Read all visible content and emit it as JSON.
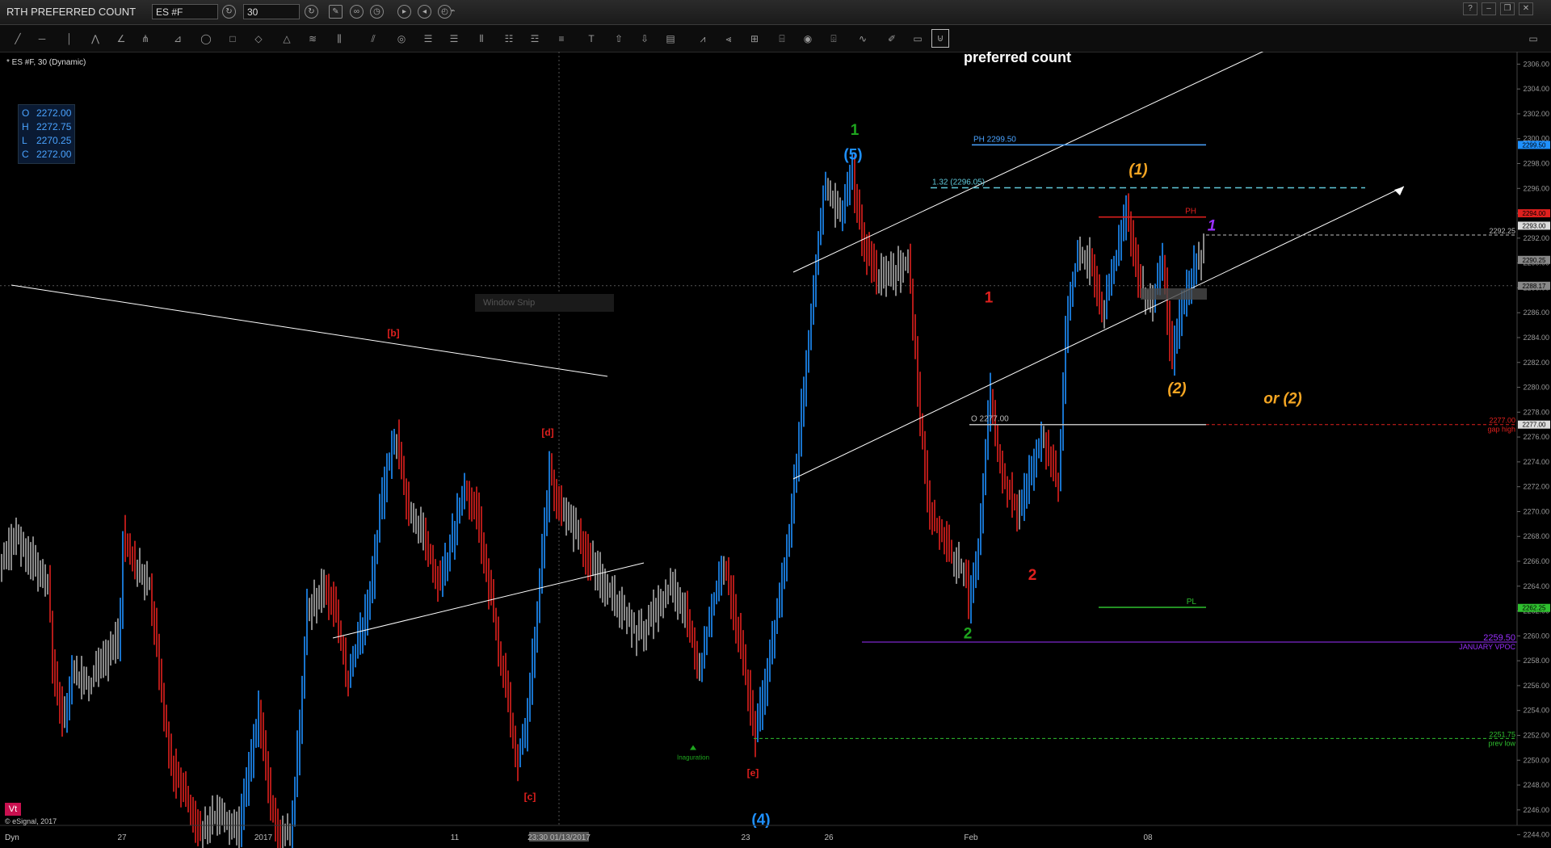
{
  "window": {
    "title": "RTH  PREFERRED COUNT",
    "symbol_field": "ES #F",
    "interval_field": "30",
    "controls": [
      "?",
      "–",
      "❐",
      "✕"
    ]
  },
  "chart_info": {
    "symbol_label": "* ES #F, 30 (Dynamic)",
    "ohlc": {
      "O": "2272.00",
      "H": "2272.75",
      "L": "2270.25",
      "C": "2272.00"
    },
    "vt_badge": "Vt",
    "copyright": "© eSignal, 2017",
    "dyn_label": "Dyn",
    "window_snip": "Window Snip"
  },
  "chart_data": {
    "type": "bar",
    "title": "preferred count",
    "ylim": [
      2243,
      2307
    ],
    "y_ticks": [
      "2306.00",
      "2304.00",
      "2302.00",
      "2300.00",
      "2298.00",
      "2296.00",
      "2294.00",
      "2292.00",
      "2290.00",
      "2288.00",
      "2286.00",
      "2284.00",
      "2282.00",
      "2280.00",
      "2278.00",
      "2276.00",
      "2274.00",
      "2272.00",
      "2270.00",
      "2268.00",
      "2266.00",
      "2264.00",
      "2262.00",
      "2260.00",
      "2258.00",
      "2256.00",
      "2254.00",
      "2252.00",
      "2250.00",
      "2248.00",
      "2246.00",
      "2244.00"
    ],
    "x_labels": [
      {
        "label": "27",
        "t": 151
      },
      {
        "label": "2017",
        "t": 326
      },
      {
        "label": "11",
        "t": 563
      },
      {
        "label": "23:30 01/13/2017",
        "t": 692,
        "highlight": true
      },
      {
        "label": "23",
        "t": 923
      },
      {
        "label": "26",
        "t": 1026
      },
      {
        "label": "Feb",
        "t": 1202
      },
      {
        "label": "08",
        "t": 1421
      }
    ],
    "price_path": [
      [
        0,
        2266
      ],
      [
        20,
        2268
      ],
      [
        40,
        2266
      ],
      [
        60,
        2264
      ],
      [
        65,
        2258
      ],
      [
        78,
        2253
      ],
      [
        90,
        2257
      ],
      [
        110,
        2256
      ],
      [
        130,
        2258
      ],
      [
        148,
        2260
      ],
      [
        152,
        2268
      ],
      [
        165,
        2266
      ],
      [
        185,
        2264
      ],
      [
        195,
        2258
      ],
      [
        210,
        2250
      ],
      [
        230,
        2247
      ],
      [
        250,
        2244
      ],
      [
        270,
        2246
      ],
      [
        295,
        2244
      ],
      [
        320,
        2254
      ],
      [
        335,
        2246
      ],
      [
        348,
        2244
      ],
      [
        360,
        2244
      ],
      [
        372,
        2254
      ],
      [
        380,
        2262
      ],
      [
        400,
        2264
      ],
      [
        415,
        2262
      ],
      [
        430,
        2256
      ],
      [
        445,
        2260
      ],
      [
        460,
        2264
      ],
      [
        470,
        2270
      ],
      [
        480,
        2274
      ],
      [
        490,
        2276
      ],
      [
        505,
        2270
      ],
      [
        525,
        2268
      ],
      [
        545,
        2264
      ],
      [
        560,
        2268
      ],
      [
        575,
        2272
      ],
      [
        590,
        2270
      ],
      [
        610,
        2262
      ],
      [
        625,
        2256
      ],
      [
        640,
        2250
      ],
      [
        650,
        2252
      ],
      [
        665,
        2262
      ],
      [
        680,
        2273
      ],
      [
        695,
        2270
      ],
      [
        715,
        2268
      ],
      [
        730,
        2266
      ],
      [
        750,
        2264
      ],
      [
        770,
        2262
      ],
      [
        790,
        2260
      ],
      [
        810,
        2262
      ],
      [
        830,
        2264
      ],
      [
        850,
        2262
      ],
      [
        865,
        2257
      ],
      [
        880,
        2262
      ],
      [
        895,
        2266
      ],
      [
        915,
        2260
      ],
      [
        925,
        2256
      ],
      [
        935,
        2252
      ],
      [
        950,
        2257
      ],
      [
        965,
        2263
      ],
      [
        980,
        2270
      ],
      [
        995,
        2280
      ],
      [
        1010,
        2290
      ],
      [
        1020,
        2296
      ],
      [
        1040,
        2294
      ],
      [
        1055,
        2297
      ],
      [
        1070,
        2291
      ],
      [
        1085,
        2289
      ],
      [
        1100,
        2289
      ],
      [
        1125,
        2290
      ],
      [
        1138,
        2278
      ],
      [
        1150,
        2270
      ],
      [
        1165,
        2268
      ],
      [
        1180,
        2266
      ],
      [
        1195,
        2265
      ],
      [
        1200,
        2262
      ],
      [
        1212,
        2268
      ],
      [
        1225,
        2280
      ],
      [
        1235,
        2275
      ],
      [
        1245,
        2272
      ],
      [
        1260,
        2270
      ],
      [
        1275,
        2273
      ],
      [
        1290,
        2276
      ],
      [
        1310,
        2272
      ],
      [
        1320,
        2286
      ],
      [
        1335,
        2291
      ],
      [
        1350,
        2290
      ],
      [
        1365,
        2286
      ],
      [
        1380,
        2290
      ],
      [
        1395,
        2294
      ],
      [
        1410,
        2288
      ],
      [
        1425,
        2287
      ],
      [
        1440,
        2290
      ],
      [
        1450,
        2282
      ],
      [
        1460,
        2286
      ],
      [
        1480,
        2290
      ],
      [
        1490,
        2291
      ]
    ],
    "pivot_labels": [
      {
        "text": "[b]",
        "t": 487,
        "p": 2284.5,
        "color": "#e0201e"
      },
      {
        "text": "[d]",
        "t": 678,
        "p": 2276.5,
        "color": "#e0201e"
      },
      {
        "text": "[c]",
        "t": 656,
        "p": 2247.2,
        "color": "#e0201e"
      },
      {
        "text": "[e]",
        "t": 932,
        "p": 2249.1,
        "color": "#e0201e"
      },
      {
        "text": "(4)",
        "t": 942,
        "p": 2245.2,
        "color": "#1e90ff"
      },
      {
        "text": "(5)",
        "t": 1056,
        "p": 2298.7,
        "color": "#1e90ff"
      },
      {
        "text": "1",
        "t": 1058,
        "p": 2300.7,
        "color": "#1ea51e"
      },
      {
        "text": "1",
        "t": 1224,
        "p": 2287.2,
        "color": "#e0201e"
      },
      {
        "text": "2",
        "t": 1278,
        "p": 2264.9,
        "color": "#e0201e"
      },
      {
        "text": "2",
        "t": 1198,
        "p": 2260.2,
        "color": "#1ea51e"
      },
      {
        "text": "(1)",
        "t": 1409,
        "p": 2297.5,
        "color": "#f5a623"
      },
      {
        "text": "(2)",
        "t": 1457,
        "p": 2279.9,
        "color": "#f5a623"
      },
      {
        "text": "or (2)",
        "t": 1588,
        "p": 2279.1,
        "color": "#f5a623"
      },
      {
        "text": "1",
        "t": 1500,
        "p": 2293.0,
        "color": "#9b30ff"
      }
    ],
    "annotations": [
      {
        "text": "PH 2299.50",
        "price": 2299.5,
        "t": 1203,
        "t_end": 1493,
        "color": "#4aa3ff"
      },
      {
        "text": "1.32 (2296.05)",
        "price": 2296.05,
        "t": 1152,
        "t_end": 1690,
        "color": "#5fc7d9",
        "dashed": true
      },
      {
        "text": "PH",
        "price": 2293.7,
        "t": 1360,
        "t_end": 1493,
        "color": "#e0201e"
      },
      {
        "text": "O 2277.00",
        "price": 2277.0,
        "t": 1200,
        "t_end": 1493,
        "color": "#bbbbbb"
      },
      {
        "text": "PL",
        "price": 2262.3,
        "t": 1360,
        "t_end": 1493,
        "color": "#2fbf2f"
      },
      {
        "text": "Inaguration",
        "price": 2250.3,
        "t": 858,
        "color": "#1ea51e"
      }
    ],
    "side_labels": [
      {
        "price": 2277.0,
        "text": "2277.00",
        "sub": "gap high",
        "color": "#e0201e"
      },
      {
        "price": 2259.5,
        "text": "2259.50",
        "sub": "JANUARY VPOC",
        "color": "#9b30ff"
      },
      {
        "price": 2251.75,
        "text": "2251.75",
        "sub": "prev low",
        "color": "#2fbf2f"
      },
      {
        "price": 2292.25,
        "text": "2292.25",
        "sub": "",
        "color": "#bbbbbb"
      }
    ],
    "axis_tags": [
      {
        "price": 2299.5,
        "text": "2299.50",
        "color": "#1e90ff"
      },
      {
        "price": 2294.0,
        "text": "2294.00",
        "color": "#e0201e"
      },
      {
        "price": 2293.0,
        "text": "2293.00",
        "color": "#dddddd"
      },
      {
        "price": 2290.25,
        "text": "2290.25",
        "color": "#888888"
      },
      {
        "price": 2288.17,
        "text": "2288.17",
        "color": "#888888"
      },
      {
        "price": 2277.0,
        "text": "2277.00",
        "color": "#dddddd"
      },
      {
        "price": 2262.25,
        "text": "2262.25",
        "color": "#2fbf2f"
      }
    ]
  }
}
